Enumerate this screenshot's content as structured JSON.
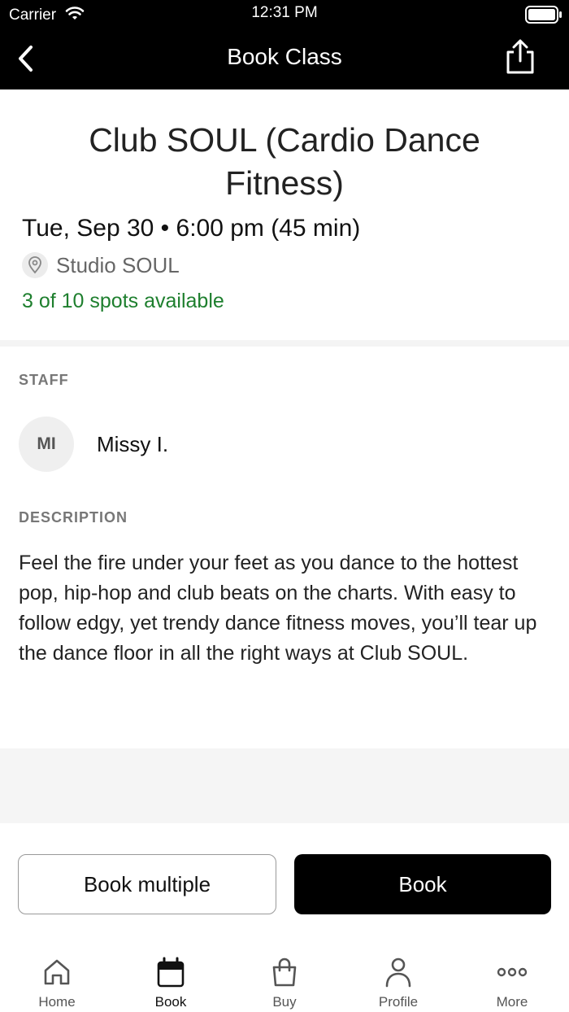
{
  "status_bar": {
    "carrier": "Carrier",
    "time": "12:31 PM"
  },
  "nav": {
    "title": "Book Class"
  },
  "class": {
    "title": "Club SOUL (Cardio Dance Fitness)",
    "datetime": "Tue, Sep 30 • 6:00 pm (45 min)",
    "location": "Studio SOUL",
    "spots": "3 of 10 spots available"
  },
  "staff": {
    "label": "STAFF",
    "initials": "MI",
    "name": "Missy I."
  },
  "description": {
    "label": "DESCRIPTION",
    "text": "Feel the fire under your feet as you dance to the hottest pop, hip-hop and club beats on the charts. With easy to follow edgy, yet trendy dance fitness moves, you’ll tear up the dance floor in all the right ways at Club SOUL."
  },
  "actions": {
    "book_multiple": "Book multiple",
    "book": "Book"
  },
  "tabs": [
    {
      "label": "Home",
      "icon": "home-icon"
    },
    {
      "label": "Book",
      "icon": "calendar-icon"
    },
    {
      "label": "Buy",
      "icon": "shopping-bag-icon"
    },
    {
      "label": "Profile",
      "icon": "person-icon"
    },
    {
      "label": "More",
      "icon": "more-dots-icon"
    }
  ],
  "colors": {
    "header_bg": "#000000",
    "spots_green": "#1e7f2e",
    "primary_button": "#000000"
  }
}
